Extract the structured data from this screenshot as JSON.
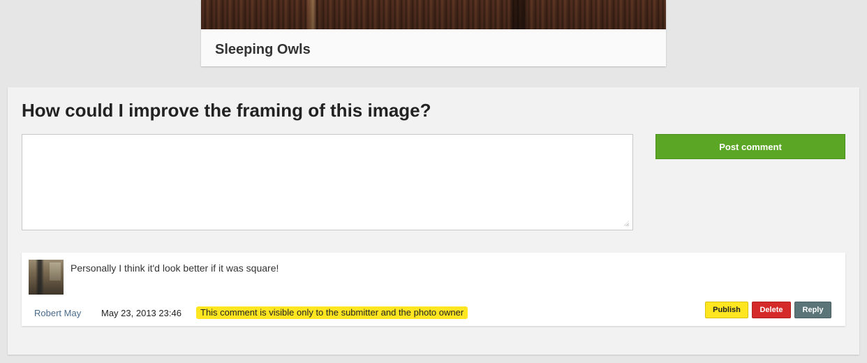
{
  "photo": {
    "title": "Sleeping Owls"
  },
  "comments_section": {
    "question": "How could I improve the framing of this image?",
    "textarea": {
      "value": "",
      "placeholder": ""
    },
    "post_button_label": "Post comment"
  },
  "comment": {
    "text": "Personally I think it'd look better if it was square!",
    "author": "Robert May",
    "date": "May 23, 2013 23:46",
    "visibility_note": "This comment is visible only to the submitter and the photo owner",
    "actions": {
      "publish": "Publish",
      "delete": "Delete",
      "reply": "Reply"
    }
  },
  "colors": {
    "post_button": "#5ba625",
    "publish_button": "#ffe620",
    "delete_button": "#d42a2a",
    "reply_button": "#5b7478",
    "visibility_badge": "#ffe620"
  }
}
